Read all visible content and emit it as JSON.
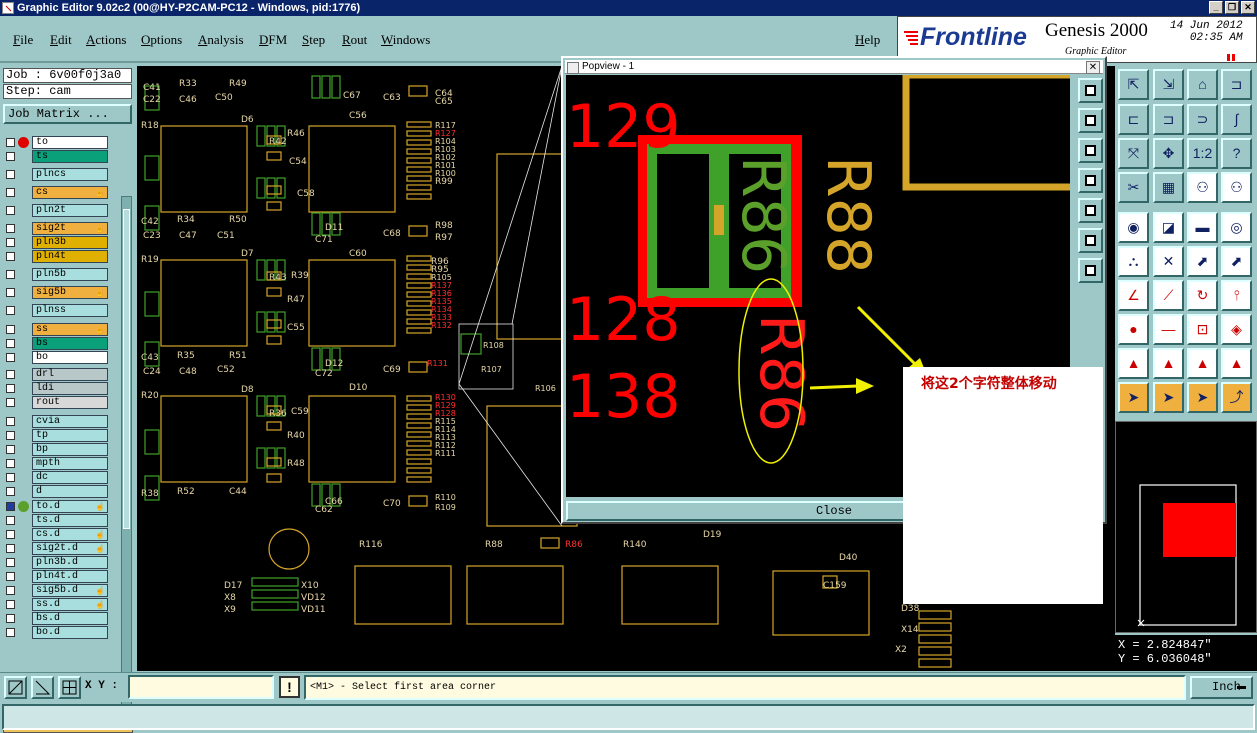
{
  "window": {
    "title": "Graphic Editor 9.02c2 (00@HY-P2CAM-PC12 - Windows, pid:1776)"
  },
  "menu": {
    "items": [
      "File",
      "Edit",
      "Actions",
      "Options",
      "Analysis",
      "DFM",
      "Step",
      "Rout",
      "Windows"
    ],
    "help": "Help"
  },
  "logo": {
    "brand": "Frontline",
    "product": "Genesis 2000",
    "subtitle": "Graphic Editor",
    "date": "14 Jun 2012",
    "time": "02:35 AM"
  },
  "job": {
    "job_label": "Job : 6v00f0j3a0",
    "step_label": "Step: cam",
    "matrix_button": "Job Matrix ...",
    "selected": "Selected : 0"
  },
  "layers": [
    {
      "name": "to",
      "color": "#ffffff",
      "dot": "#e00000"
    },
    {
      "name": "ts",
      "color": "#0aa07a"
    },
    {
      "name": "plncs",
      "color": "#a8dede"
    },
    {
      "name": "cs",
      "color": "#f0b040",
      "cursor": true
    },
    {
      "name": "pln2t",
      "color": "#a8dede"
    },
    {
      "name": "sig2t",
      "color": "#f0b040",
      "cursor": true
    },
    {
      "name": "pln3b",
      "color": "#e0b000"
    },
    {
      "name": "pln4t",
      "color": "#e0b000"
    },
    {
      "name": "pln5b",
      "color": "#a8dede"
    },
    {
      "name": "sig5b",
      "color": "#f0b040",
      "cursor": true
    },
    {
      "name": "plnss",
      "color": "#a8dede"
    },
    {
      "name": "ss",
      "color": "#f0b040",
      "cursor": true
    },
    {
      "name": "bs",
      "color": "#0aa07a"
    },
    {
      "name": "bo",
      "color": "#ffffff"
    },
    {
      "name": "drl",
      "color": "#b8c8c8"
    },
    {
      "name": "ldi",
      "color": "#b8c8c8"
    },
    {
      "name": "rout",
      "color": "#d8d8d8"
    },
    {
      "name": "cvia",
      "color": "#a8dede"
    },
    {
      "name": "tp",
      "color": "#a8dede"
    },
    {
      "name": "bp",
      "color": "#a8dede"
    },
    {
      "name": "mpth",
      "color": "#a8dede"
    },
    {
      "name": "dc",
      "color": "#a8dede"
    },
    {
      "name": "d",
      "color": "#a8dede"
    },
    {
      "name": "to.d",
      "color": "#a8dede",
      "dot": "#5aa02a",
      "checked": true,
      "cursor": true
    },
    {
      "name": "ts.d",
      "color": "#a8dede"
    },
    {
      "name": "cs.d",
      "color": "#a8dede",
      "cursor": true
    },
    {
      "name": "sig2t.d",
      "color": "#a8dede",
      "cursor": true
    },
    {
      "name": "pln3b.d",
      "color": "#a8dede"
    },
    {
      "name": "pln4t.d",
      "color": "#a8dede"
    },
    {
      "name": "sig5b.d",
      "color": "#a8dede",
      "cursor": true
    },
    {
      "name": "ss.d",
      "color": "#a8dede",
      "cursor": true
    },
    {
      "name": "bs.d",
      "color": "#a8dede"
    },
    {
      "name": "bo.d",
      "color": "#a8dede"
    }
  ],
  "board": {
    "labels": [
      "R33",
      "R49",
      "C41",
      "C22",
      "C46",
      "C50",
      "R18",
      "D6",
      "R42",
      "R34",
      "R50",
      "C42",
      "C23",
      "C47",
      "C51",
      "R19",
      "D7",
      "R43",
      "R35",
      "R51",
      "C43",
      "C24",
      "C48",
      "C52",
      "R20",
      "D8",
      "R36",
      "R52",
      "C44",
      "R38",
      "R46",
      "C54",
      "C58",
      "R39",
      "R47",
      "C55",
      "C59",
      "R40",
      "R48",
      "C56",
      "C60",
      "D10",
      "D11",
      "D12",
      "C66",
      "C67",
      "C68",
      "C69",
      "C70",
      "C71",
      "C72",
      "C62",
      "C63",
      "C64",
      "C65",
      "R117",
      "R127",
      "R104",
      "R103",
      "R102",
      "R101",
      "R100",
      "R99",
      "R98",
      "R97",
      "R96",
      "R95",
      "R105",
      "R137",
      "R136",
      "R135",
      "R134",
      "R133",
      "R132",
      "R131",
      "R130",
      "R129",
      "R128",
      "R115",
      "R114",
      "R113",
      "R112",
      "R111",
      "R110",
      "R109",
      "R108",
      "R107",
      "R106",
      "R116",
      "R88",
      "R86",
      "R140",
      "D19",
      "D40",
      "C159",
      "D38",
      "X14",
      "X2",
      "D17",
      "X8",
      "X9",
      "X10",
      "VD12",
      "VD11",
      "VD10",
      "R82",
      "R81",
      "R80"
    ],
    "zoom_labels": [
      "R86",
      "R88",
      "R86",
      "129",
      "128",
      "138"
    ]
  },
  "popview": {
    "title": "Popview - 1",
    "close": "Close"
  },
  "annotation": "将这2个字符整体移动",
  "coords": {
    "x": "X = 2.824847\"",
    "y": "Y = 6.036048\""
  },
  "status": {
    "xy_label": "X Y :",
    "message": "<M1> - Select first area corner",
    "units": "Inch"
  }
}
